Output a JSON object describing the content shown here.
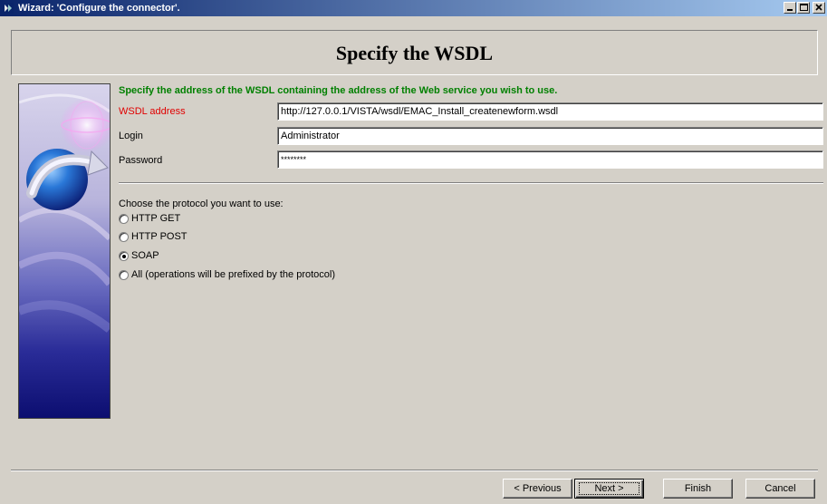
{
  "window": {
    "title": "Wizard: 'Configure the connector'.",
    "controls": [
      "minimize-icon",
      "maximize-icon",
      "close-icon"
    ]
  },
  "header": {
    "title": "Specify the WSDL"
  },
  "form": {
    "instruction": "Specify the address of the WSDL containing the address of the Web service you wish to use.",
    "wsdl_label": "WSDL address",
    "wsdl_value": "http://127.0.0.1/VISTA/wsdl/EMAC_Install_createnewform.wsdl",
    "login_label": "Login",
    "login_value": "Administrator",
    "password_label": "Password",
    "password_value": "********"
  },
  "protocol": {
    "label": "Choose the protocol you want to use:",
    "options": [
      {
        "label": "HTTP GET",
        "selected": false
      },
      {
        "label": "HTTP POST",
        "selected": false
      },
      {
        "label": "SOAP",
        "selected": true
      },
      {
        "label": "All (operations will be prefixed by the protocol)",
        "selected": false
      }
    ]
  },
  "buttons": {
    "previous": "< Previous",
    "next": "Next >",
    "finish": "Finish",
    "cancel": "Cancel"
  },
  "colors": {
    "title_bar_start": "#0a246a",
    "title_bar_end": "#a6caf0",
    "dialog_bg": "#d4d0c8",
    "instruction_text": "#008000",
    "required_label": "#e00000"
  }
}
